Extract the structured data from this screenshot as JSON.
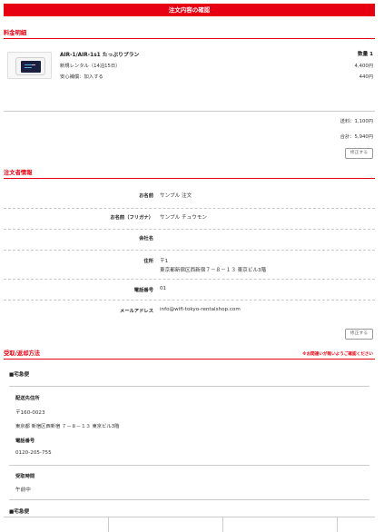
{
  "header": {
    "title": "注文内容の確認"
  },
  "pricing": {
    "section_title": "料金明細",
    "plan_name": "AIR-1/AIR-1s1 たっぷりプラン",
    "quantity_label": "数量 1",
    "items": [
      {
        "label": "新規レンタル（14泊15日）",
        "price": "4,400円"
      },
      {
        "label": "安心補償：加入する",
        "price": "440円"
      }
    ],
    "shipping": "送料：1,100円",
    "total": "合計：5,940円",
    "edit_label": "修正する"
  },
  "orderer": {
    "section_title": "注文者情報",
    "fields": [
      {
        "label": "お名前",
        "value": "サンプル 注文"
      },
      {
        "label": "お名前（フリガナ）",
        "value": "サンプル チュウモン"
      },
      {
        "label": "会社名",
        "value": ""
      },
      {
        "label": "住所",
        "value_line1": "〒1",
        "value_line2": "東京都新宿区西新宿７－８－１３ 東京ビル3階"
      },
      {
        "label": "電話番号",
        "value": "01"
      },
      {
        "label": "メールアドレス",
        "value": "info@wifi-tokyo-rentalshop.com"
      }
    ],
    "edit_label": "修正する"
  },
  "delivery": {
    "section_title": "受取/返却方法",
    "note": "※お間違いが無いようご確認ください",
    "method": "■宅急便",
    "address_label": "配送先住所",
    "postal": "〒160-0023",
    "address": "東京都 新宿区西新宿 ７－８－１３ 東京ビル3階",
    "phone_label": "電話番号",
    "phone": "0120-205-755",
    "time_label": "受取時間",
    "time": "午前中",
    "return_method": "■宅急便"
  },
  "colors": {
    "accent": "#e60012",
    "border": "#cccccc"
  }
}
